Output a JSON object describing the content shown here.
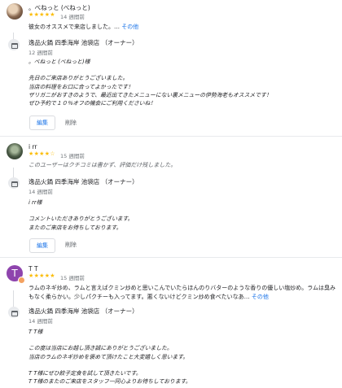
{
  "reviews": [
    {
      "name": "。べねっと (べねっと)",
      "stars": "★★★★★",
      "time": "14 週間前",
      "text": "彼女のオススメで来店しました。…",
      "more": "その他",
      "owner": {
        "name": "逸品火鍋 四季海岸 池袋店 （オーナー）",
        "time": "12 週間前",
        "reply": "。べねっと (べねっと)様\n\n先日のご来店ありがとうございました。\n当店の料理をお口に合ってよかったです！\nザリガニがおすきのようで、最近出てきたメニューにない裏メニューの伊勢海老もオススメです！\nぜひ予約で１０％オフの機会にご利用くださいね！"
      },
      "edit_label": "編集",
      "delete_label": "削除"
    },
    {
      "name": "i rr",
      "stars": "★★★★☆",
      "time": "15 週間前",
      "text": "このユーザーはクチコミは書かず、評価だけ残しました。",
      "owner": {
        "name": "逸品火鍋 四季海岸 池袋店 （オーナー）",
        "time": "14 週間前",
        "reply": "i rr様\n\nコメントいただきありがとうございます。\nまたのご来店をお待ちしております。"
      },
      "edit_label": "編集",
      "delete_label": "削除"
    },
    {
      "name": "T T",
      "avatar_letter": "T",
      "stars": "★★★★★",
      "time": "15 週間前",
      "text": "ラムのネギ炒め、ラムと言えばクミン炒めと思いこんでいたらほんのりバターのような香りの優しい塩炒め。ラムは臭みもなく柔らかい。少しパクチーも入ってます。悪くないけどクミン炒め食べたいなあ…",
      "more": "その他",
      "owner": {
        "name": "逸品火鍋 四季海岸 池袋店 （オーナー）",
        "time": "14 週間前",
        "reply": "T T様\n\nこの度は当店にお越し頂き誠にありがとうございました。\n当店のラムのネギ炒めを褒めて頂けたこと大変嬉しく思います。\n\nT T様にぜひ餃子定食を試して頂きたいです。\nT T様のまたのご来店をスタッフ一同心よりお待ちしております。"
      }
    }
  ]
}
